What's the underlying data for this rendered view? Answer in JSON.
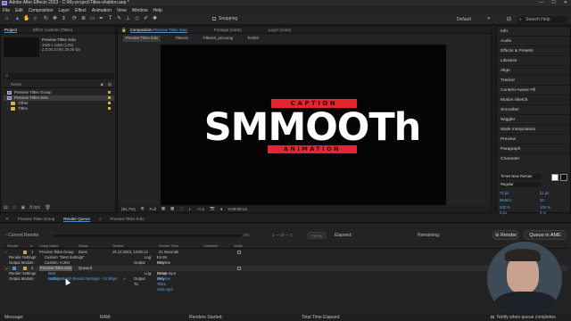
{
  "window": {
    "title": "Adobe After Effects 2023 - C:\\My-project\\Titles-shablon.aep *",
    "app_badge": "Ae",
    "controls": [
      "—",
      "☐",
      "✕"
    ]
  },
  "menu": [
    "File",
    "Edit",
    "Composition",
    "Layer",
    "Effect",
    "Animation",
    "View",
    "Window",
    "Help"
  ],
  "toolbar": {
    "snapping_label": "Snapping",
    "workspace": "Default",
    "search_placeholder": "Search Help"
  },
  "project_panel": {
    "tab_project": "Project",
    "tab_effect_controls": "Effect Controls  (Titles)",
    "selected_name": "Preview Titles Solo",
    "selected_info_1": "1920 x 1080 (1,00)",
    "selected_info_2": "Δ 0:00:10:00, 25,00 fps",
    "search_placeholder": "ρ",
    "col_name": "Name",
    "items": [
      {
        "name": "Preview Titles Group",
        "type": "comp",
        "color": "#c2a84d"
      },
      {
        "name": "Preview Titles Solo",
        "type": "comp",
        "color": "#c2a84d"
      },
      {
        "name": "Other",
        "type": "folder",
        "color": "#d8b34a"
      },
      {
        "name": "Titles",
        "type": "folder",
        "color": "#d8b34a"
      }
    ],
    "bpc": "8 bpc"
  },
  "composition_panel": {
    "tab_label": "Composition",
    "tab_comp_name": "Preview Titles Solo",
    "tab_footage": "Footage  (none)",
    "tab_layer": "Layer  (none)",
    "breadcrumbs": [
      "Preview Titles Solo",
      "Titles01",
      "Titles03_precomp",
      "Text03"
    ],
    "title_caption": "CAPTION",
    "title_main": "SMMOOTh",
    "title_sub": "ANIMATION",
    "zoom": "(91,7%)",
    "resolution": "Full",
    "exposure": "+0,0",
    "timecode": "0:00:00:14"
  },
  "right_panel": {
    "items": [
      "Info",
      "Audio",
      "Effects & Presets",
      "Libraries",
      "Align",
      "Tracker",
      "Content-Aware Fill",
      "Motion Sketch",
      "Smoother",
      "Wiggler",
      "Mask Interpolation",
      "Preview",
      "Paragraph"
    ],
    "character": {
      "title": "Character",
      "font": "Times New Roman",
      "style": "Regular",
      "size": "73 px",
      "leading": "51 px",
      "kerning": "Metrics",
      "tracking": "20",
      "vscale": "100 %",
      "hscale": "100 %",
      "baseline": "0 px",
      "tsume": "0 %"
    }
  },
  "timeline_tabs": [
    {
      "label": "Preview Titles Group"
    },
    {
      "label": "Render Queue"
    },
    {
      "label": "Preview Titles Solo"
    }
  ],
  "render_queue": {
    "current_render_label": "Current Render",
    "progress": "0%",
    "of": "1 — of — 1",
    "elapsed_label": "Elapsed:",
    "remaining_label": "Remaining:",
    "ame_button": "Queue in AME",
    "render_button": "Render",
    "columns": [
      "Render",
      "#",
      "Comp Name",
      "Status",
      "Started",
      "Render Time",
      "Comment",
      "Notify"
    ],
    "item1": {
      "num": "1",
      "comp": "Preview Titles Group",
      "status": "Done",
      "started": "15.12.2023, 13:05:13",
      "render_time": "21 Seconds",
      "render_settings_label": "Render Settings:",
      "render_settings_value": "Custom: \"Best Settings\"",
      "log_label": "Log:",
      "log_value": "Errors Only",
      "output_module_label": "Output Module:",
      "output_module_value": "Custom: H.264",
      "output_to_label": "Output To:",
      "output_to_value": "Preview Titles Group.mp4"
    },
    "item2": {
      "num": "2",
      "comp": "Preview Titles Solo",
      "status": "Queued",
      "render_settings_label": "Render Settings:",
      "render_settings_value": "Best Settings",
      "log_label": "Log:",
      "log_value": "Errors Only",
      "output_module_label": "Output Module:",
      "output_module_value": "H.264 - Match Render Settings - 15 Mbps",
      "output_to_label": "Output To:",
      "output_to_value": "Preview Titles Solo.mp4"
    }
  },
  "status_bar": {
    "message_label": "Message:",
    "ram_label": "RAM:",
    "renders_started_label": "Renders Started:",
    "total_time_label": "Total Time Elapsed:",
    "notify_label": "Notify when queue completes"
  },
  "colors": {
    "accent_blue": "#4a90d9",
    "title_red": "#e5262f"
  }
}
